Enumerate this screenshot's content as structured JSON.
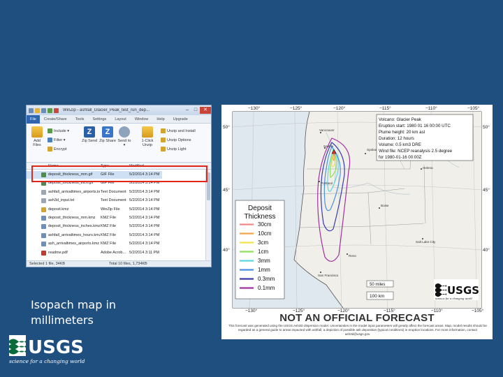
{
  "winzip": {
    "title": "WinZip - ashfall_Glacier_Peak_test_run_dep...",
    "tabs": [
      "File",
      "Create/Share",
      "Tools",
      "Settings",
      "Layout",
      "Window",
      "Help",
      "Upgrade"
    ],
    "window_buttons": [
      "–",
      "□",
      "✕"
    ],
    "ribbon": {
      "add_files": "Add Files",
      "include": "Include ▾",
      "filter": "Filter ▾",
      "encrypt": "Encrypt",
      "zip_send": "Zip Send",
      "zip_share": "Zip Share",
      "send_to": "Send to ▾",
      "unzip": "1-Click Unzip",
      "unzip_install": "Unzip and Install",
      "unzip_options": "Unzip Options",
      "unzip_light": "Unzip Light"
    },
    "columns": {
      "name": "Name",
      "type": "Type",
      "modified": "Modified"
    },
    "files": [
      {
        "name": "deposit_thickness_mm.gif",
        "type": "GIF File",
        "modified": "5/2/2014 3:14 PM",
        "icon": "gif-file-icon",
        "color": "#4f8e4a"
      },
      {
        "name": "deposit_thickness_inch.gif",
        "type": "GIF File",
        "modified": "5/2/2014 3:14 PM",
        "icon": "gif-file-icon",
        "color": "#4f8e4a"
      },
      {
        "name": "ashfall_arrivaltimes_airports.txt",
        "type": "Text Document",
        "modified": "5/2/2014 3:14 PM",
        "icon": "text-file-icon",
        "color": "#9aa7b5"
      },
      {
        "name": "ash3d_input.txt",
        "type": "Text Document",
        "modified": "5/2/2014 3:14 PM",
        "icon": "text-file-icon",
        "color": "#9aa7b5"
      },
      {
        "name": "deposit.kmz",
        "type": "WinZip File",
        "modified": "5/2/2014 3:14 PM",
        "icon": "zip-file-icon",
        "color": "#d3a52e"
      },
      {
        "name": "deposit_thickness_mm.kmz",
        "type": "KMZ File",
        "modified": "5/2/2014 3:14 PM",
        "icon": "kmz-file-icon",
        "color": "#6b8fbf"
      },
      {
        "name": "deposit_thickness_inches.kmz",
        "type": "KMZ File",
        "modified": "5/2/2014 3:14 PM",
        "icon": "kmz-file-icon",
        "color": "#6b8fbf"
      },
      {
        "name": "ashfall_arrivaltimes_hours.kmz",
        "type": "KMZ File",
        "modified": "5/2/2014 3:14 PM",
        "icon": "kmz-file-icon",
        "color": "#6b8fbf"
      },
      {
        "name": "ash_arrivaltimes_airports.kmz",
        "type": "KMZ File",
        "modified": "5/2/2014 3:14 PM",
        "icon": "kmz-file-icon",
        "color": "#6b8fbf"
      },
      {
        "name": "readme.pdf",
        "type": "Adobe Acrob...",
        "modified": "5/2/2014 3:11 PM",
        "icon": "pdf-file-icon",
        "color": "#c23b2c"
      }
    ],
    "status_left": "Selected 1 file, 34KB",
    "status_right": "Total 10 files, 1,734KB"
  },
  "caption": "Isopach map in millimeters",
  "logo": {
    "text": "USGS",
    "tagline": "science for a changing world"
  },
  "map": {
    "lon_labels": [
      "−130°",
      "−125°",
      "−120°",
      "−115°",
      "−110°",
      "−105°"
    ],
    "lat_labels": [
      "50°",
      "45°",
      "40°"
    ],
    "info": [
      "Volcano: Glacier Peak",
      "Eruption start: 1980 01 16 00:00 UTC",
      "Plume height: 20 km asl",
      "Duration: 12 hours",
      "Volume: 0.5 km3 DRE",
      "Wind file: NCEP reanalysis 2.5 degree",
      "for 1980-01-16 00:00Z"
    ],
    "legend": {
      "title": "Deposit Thickness",
      "items": [
        {
          "label": "30cm",
          "color": "#f08a8a"
        },
        {
          "label": "10cm",
          "color": "#f2a44a"
        },
        {
          "label": "3cm",
          "color": "#f0e34a"
        },
        {
          "label": "1cm",
          "color": "#8ee05a"
        },
        {
          "label": "3mm",
          "color": "#5ad8e0"
        },
        {
          "label": "1mm",
          "color": "#4a90e0"
        },
        {
          "label": "0.3mm",
          "color": "#3a3ab0"
        },
        {
          "label": "0.1mm",
          "color": "#a030a0"
        }
      ]
    },
    "scale": {
      "miles": "50 miles",
      "km": "100 km"
    },
    "cities": [
      "Vancouver",
      "Seattle",
      "Portland",
      "Spokane",
      "Boise",
      "Helena",
      "Reno",
      "Salt Lake City",
      "San Francisco"
    ],
    "title": "NOT AN OFFICIAL FORECAST",
    "disclaimer": "This forecast was generated using the USGS Ash3D dispersion model. Uncertainties in the model input parameters will greatly affect the forecast areas. Map, model results should be regarded as a general guide to areas impacted with ashfall, a depiction of possible ash deposition (typical conditions) in eruption locations. For more information, contact ash3d@usgs.gov."
  }
}
